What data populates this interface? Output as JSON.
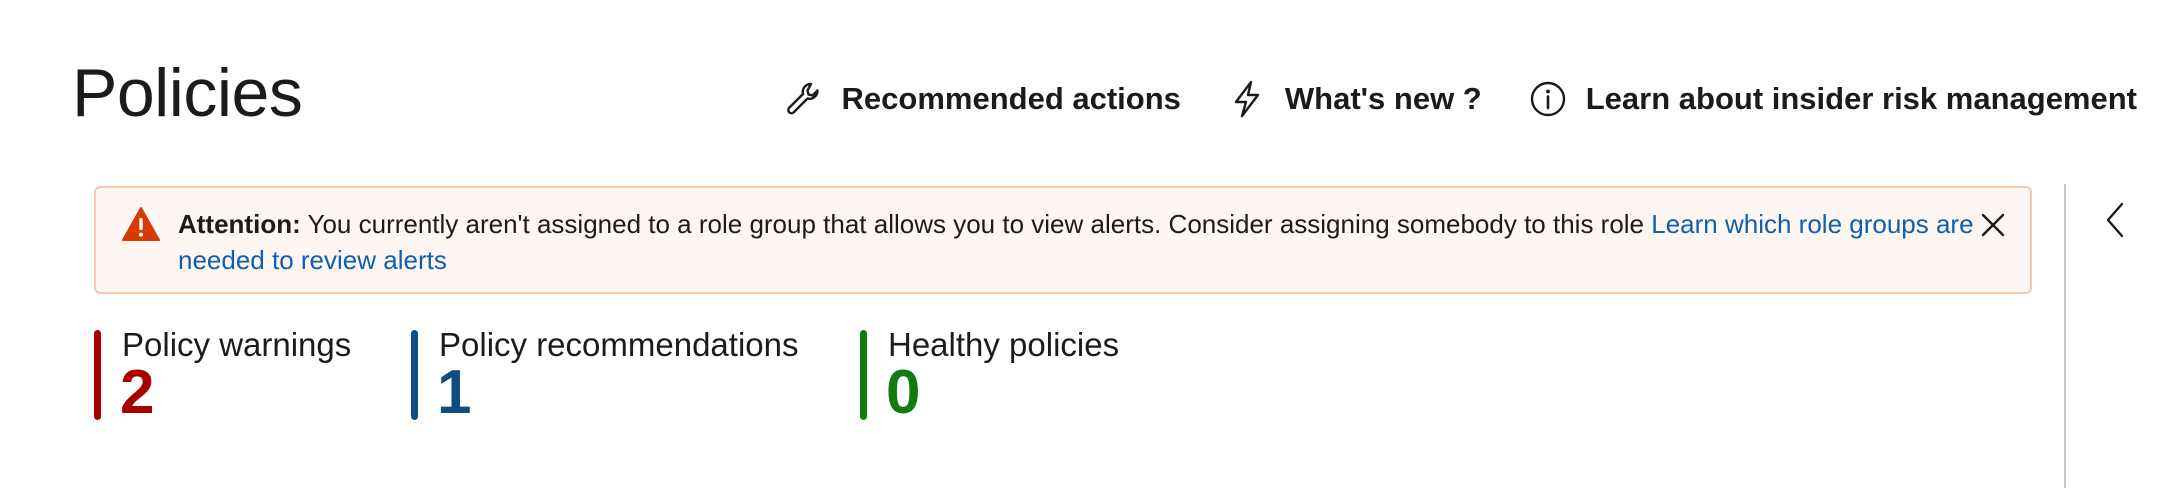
{
  "page": {
    "title": "Policies"
  },
  "header_actions": [
    {
      "label": "Recommended actions",
      "icon": "wrench-icon"
    },
    {
      "label": "What's new ?",
      "icon": "lightning-icon"
    },
    {
      "label": "Learn about insider risk management",
      "icon": "info-icon"
    }
  ],
  "banner": {
    "title": "Attention:",
    "message": " You currently aren't assigned to a role group that allows you to view alerts. Consider assigning somebody to this role ",
    "link_text": "Learn which role groups are needed to review alerts",
    "icon": "warning-icon",
    "close_icon": "close-icon",
    "colors": {
      "background": "#fdf6f2",
      "border": "#f6c9ae",
      "icon": "#d83b01",
      "link": "#0f5fb0"
    }
  },
  "side_panel": {
    "toggle_icon": "chevron-left-icon"
  },
  "stats": [
    {
      "label": "Policy warnings",
      "value": "2",
      "color": "#a80000"
    },
    {
      "label": "Policy recommendations",
      "value": "1",
      "color": "#0f4c81"
    },
    {
      "label": "Healthy policies",
      "value": "0",
      "color": "#107c10"
    }
  ]
}
